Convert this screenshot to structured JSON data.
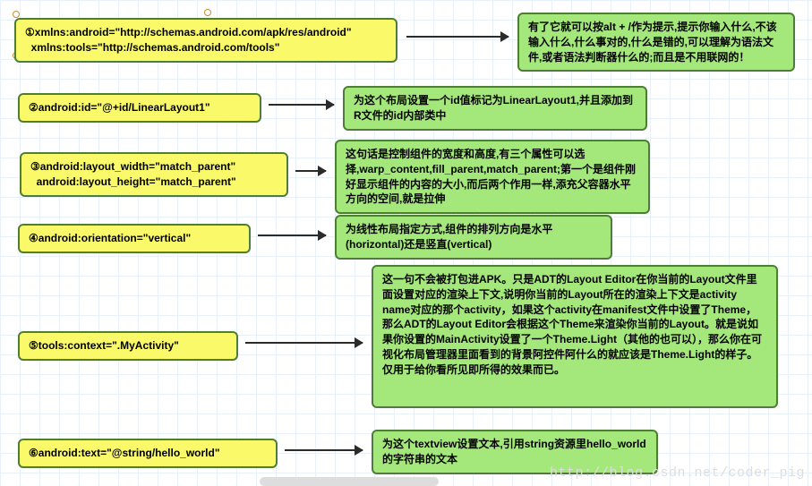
{
  "rows": [
    {
      "num": "①",
      "code": "xmlns:android=\"http://schemas.android.com/apk/res/android\"\n  xmlns:tools=\"http://schemas.android.com/tools\"",
      "desc": "有了它就可以按alt + /作为提示,提示你输入什么,不该输入什么,什么事对的,什么是错的,可以理解为语法文件,或者语法判断器什么的;而且是不用联网的！",
      "yL": 16,
      "yT": 20,
      "yW": 428,
      "yH": 40,
      "gL": 578,
      "gT": 14,
      "gW": 310,
      "gH": 52,
      "aL": 454,
      "aT": 40,
      "aW": 114
    },
    {
      "num": "②",
      "code": "android:id=\"@+id/LinearLayout1\"",
      "desc": "为这个布局设置一个id值标记为LinearLayout1,并且添加到R文件的id内部类中",
      "yL": 20,
      "yT": 104,
      "yW": 272,
      "yH": 26,
      "gL": 383,
      "gT": 96,
      "gW": 340,
      "gH": 40,
      "aL": 300,
      "aT": 116,
      "aW": 73
    },
    {
      "num": "③",
      "code": "android:layout_width=\"match_parent\"\n  android:layout_height=\"match_parent\"",
      "desc": "这句话是控制组件的宽度和高度,有三个属性可以选择,warp_content,fill_parent,match_parent;第一个是组件刚好显示组件的内容的大小,而后两个作用一样,添充父容器水平方向的空间,就是拉伸",
      "yL": 22,
      "yT": 170,
      "yW": 300,
      "yH": 40,
      "gL": 374,
      "gT": 156,
      "gW": 352,
      "gH": 68,
      "aL": 330,
      "aT": 190,
      "aW": 34
    },
    {
      "num": "④",
      "code": "android:orientation=\"vertical\"",
      "desc": "为线性布局指定方式,组件的排列方向是水平(horizontal)还是竖直(vertical)",
      "yL": 20,
      "yT": 250,
      "yW": 260,
      "yH": 26,
      "gL": 374,
      "gT": 240,
      "gW": 310,
      "gH": 40,
      "aL": 288,
      "aT": 262,
      "aW": 76
    },
    {
      "num": "⑤",
      "code": "tools:context=\".MyActivity\"",
      "desc": "这一句不会被打包进APK。只是ADT的Layout Editor在你当前的Layout文件里面设置对应的渲染上下文,说明你当前的Layout所在的渲染上下文是activity name对应的那个activity，如果这个activity在manifest文件中设置了Theme，那么ADT的Layout Editor会根据这个Theme来渲染你当前的Layout。就是说如果你设置的MainActivity设置了一个Theme.Light（其他的也可以），那么你在可视化布局管理器里面看到的背景阿控件阿什么的就应该是Theme.Light的样子。仅用于给你看所见即所得的效果而已。",
      "yL": 20,
      "yT": 370,
      "yW": 246,
      "yH": 26,
      "gL": 415,
      "gT": 296,
      "gW": 454,
      "gH": 160,
      "aL": 274,
      "aT": 382,
      "aW": 131
    },
    {
      "num": "⑥",
      "code": "android:text=\"@string/hello_world\"",
      "desc": "为这个textview设置文本,引用string资源里hello_world的字符串的文本",
      "yL": 20,
      "yT": 490,
      "yW": 290,
      "yH": 26,
      "gL": 415,
      "gT": 480,
      "gW": 320,
      "gH": 40,
      "aL": 318,
      "aT": 502,
      "aW": 87
    }
  ],
  "watermark": "http://blog.csdn.net/coder_pig"
}
